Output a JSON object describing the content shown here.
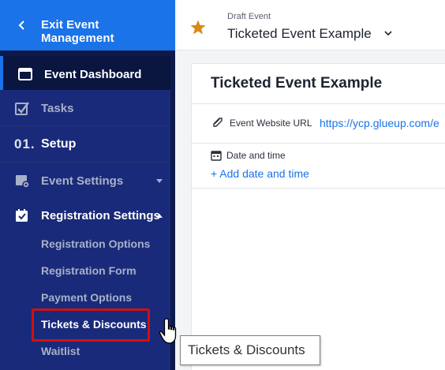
{
  "sidebar": {
    "exit_label": "Exit Event Management",
    "items": [
      {
        "label": "Event Dashboard",
        "icon": "calendar-window-icon",
        "active": true
      },
      {
        "label": "Tasks",
        "icon": "checkbox-icon"
      },
      {
        "number": "01.",
        "label": "Setup"
      },
      {
        "label": "Event Settings",
        "icon": "settings-calendar-icon",
        "expanded": false
      },
      {
        "label": "Registration Settings",
        "icon": "registration-calendar-icon",
        "expanded": true
      }
    ],
    "sub_items": [
      {
        "label": "Registration Options"
      },
      {
        "label": "Registration Form"
      },
      {
        "label": "Payment Options"
      },
      {
        "label": "Tickets & Discounts",
        "active": true
      },
      {
        "label": "Waitlist"
      }
    ]
  },
  "header": {
    "status": "Draft Event",
    "title": "Ticketed Event Example"
  },
  "card": {
    "title": "Ticketed Event Example",
    "url_label": "Event Website URL",
    "url_value": "https://ycp.glueup.com/e",
    "date_label": "Date and time",
    "add_date_link": "+ Add date and time"
  },
  "tooltip": "Tickets & Discounts",
  "colors": {
    "sidebar_bg": "#0d1a4a",
    "sidebar_section_bg": "#1a2a7a",
    "accent": "#1a73e8",
    "highlight": "#d01010",
    "star": "#d8891a"
  }
}
